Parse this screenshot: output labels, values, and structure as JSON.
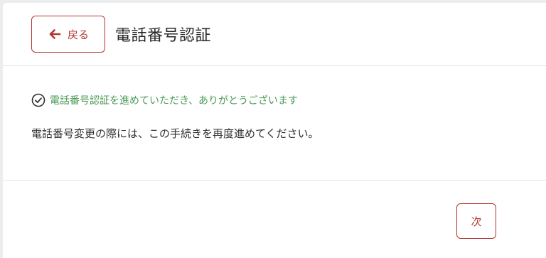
{
  "header": {
    "back_label": "戻る",
    "title": "電話番号認証",
    "back_icon": "arrow-left-icon"
  },
  "main": {
    "success_icon": "check-circle-icon",
    "success_message": "電話番号認証を進めていただき、ありがとうございます",
    "description": "電話番号変更の際には、この手続きを再度進めてください。"
  },
  "footer": {
    "next_label": "次"
  },
  "colors": {
    "accent": "#b3352e",
    "success": "#4a9a56",
    "background": "#ecedef"
  }
}
